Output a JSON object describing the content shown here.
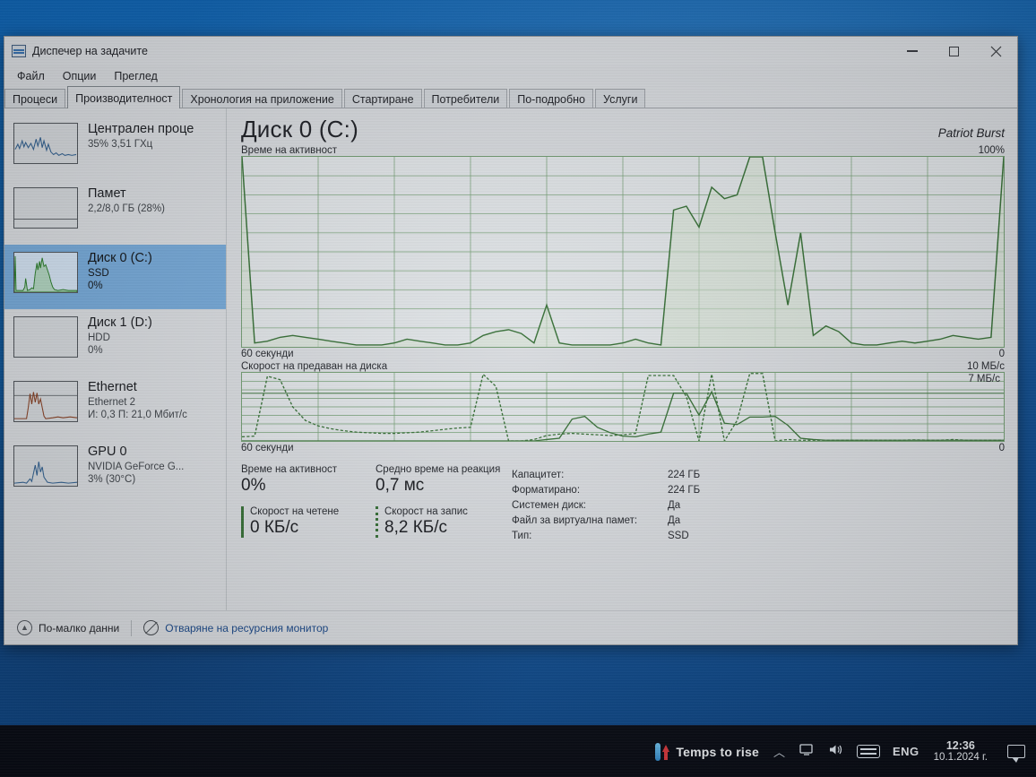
{
  "window": {
    "title": "Диспечер на задачите",
    "app_icon": "task-manager-icon",
    "minimize_label": "—",
    "maximize_label": "□",
    "close_label": "✕"
  },
  "menubar": {
    "items": [
      {
        "label": "Файл"
      },
      {
        "label": "Опции"
      },
      {
        "label": "Преглед"
      }
    ]
  },
  "tabs": {
    "active_index": 1,
    "items": [
      {
        "label": "Процеси"
      },
      {
        "label": "Производителност"
      },
      {
        "label": "Хронология на приложение"
      },
      {
        "label": "Стартиране"
      },
      {
        "label": "Потребители"
      },
      {
        "label": "По-подробно"
      },
      {
        "label": "Услуги"
      }
    ]
  },
  "sidebar": {
    "items": [
      {
        "title": "Централен проце",
        "sub1": "35% 3,51 ГХц",
        "sub2": "",
        "selected": false,
        "thumb": "cpu-sparkline"
      },
      {
        "title": "Памет",
        "sub1": "2,2/8,0 ГБ (28%)",
        "sub2": "",
        "selected": false,
        "thumb": "memory-sparkline"
      },
      {
        "title": "Диск 0 (C:)",
        "sub1": "SSD",
        "sub2": "0%",
        "selected": true,
        "thumb": "disk0-sparkline"
      },
      {
        "title": "Диск 1 (D:)",
        "sub1": "HDD",
        "sub2": "0%",
        "selected": false,
        "thumb": "disk1-sparkline"
      },
      {
        "title": "Ethernet",
        "sub1": "Ethernet 2",
        "sub2": "И: 0,3 П: 21,0 Мбит/с",
        "selected": false,
        "thumb": "ethernet-sparkline"
      },
      {
        "title": "GPU 0",
        "sub1": "NVIDIA GeForce G...",
        "sub2": "3% (30°C)",
        "selected": false,
        "thumb": "gpu-sparkline"
      }
    ]
  },
  "main": {
    "title": "Диск 0 (C:)",
    "model": "Patriot Burst",
    "activity_graph": {
      "caption": "Време на активност",
      "scale_max": "100%",
      "axis_left": "60 секунди",
      "axis_right": "0"
    },
    "transfer_graph": {
      "caption": "Скорост на предаван на диска",
      "scale_max": "10 МБ/с",
      "scale_inner": "7 МБ/с",
      "axis_left": "60 секунди",
      "axis_right": "0"
    },
    "stats": {
      "active_time_label": "Време на активност",
      "active_time_value": "0%",
      "avg_response_label": "Средно време на реакция",
      "avg_response_value": "0,7 мс",
      "read_label": "Скорост на четене",
      "read_value": "0 КБ/с",
      "write_label": "Скорост на запис",
      "write_value": "8,2 КБ/с",
      "info_rows": [
        {
          "key": "Капацитет:",
          "value": "224 ГБ"
        },
        {
          "key": "Форматирано:",
          "value": "224 ГБ"
        },
        {
          "key": "Системен диск:",
          "value": "Да"
        },
        {
          "key": "Файл за виртуална памет:",
          "value": "Да"
        },
        {
          "key": "Тип:",
          "value": "SSD"
        }
      ]
    }
  },
  "footer": {
    "fewer_details_label": "По-малко данни",
    "fewer_details_icon": "chevron-up-circle-icon",
    "resource_monitor_label": "Отваряне на ресурсния монитор",
    "resource_monitor_icon": "resource-monitor-icon"
  },
  "taskbar": {
    "temps_label": "Temps to rise",
    "temps_icon": "thermometer-icon",
    "chevron_icon": "chevron-up-icon",
    "network_icon": "network-icon",
    "volume_icon": "volume-icon",
    "keyboard_icon": "keyboard-icon",
    "language": "ENG",
    "time": "12:36",
    "date": "10.1.2024 г.",
    "notifications_icon": "action-center-icon"
  },
  "colors": {
    "graph_line": "#2f6e2f",
    "graph_fill": "#cfe0cd",
    "graph_border": "#6e9d6e",
    "selection": "#6fa8dc",
    "link": "#13458c",
    "window_bg": "#d7dade"
  },
  "chart_data": [
    {
      "type": "area",
      "id": "disk-active-time",
      "title": "Време на активност",
      "xlabel": "60 секунди",
      "ylabel": "%",
      "ylim": [
        0,
        100
      ],
      "grid": true,
      "x": [
        0,
        1,
        2,
        3,
        4,
        5,
        6,
        7,
        8,
        9,
        10,
        11,
        12,
        13,
        14,
        15,
        16,
        17,
        18,
        19,
        20,
        21,
        22,
        23,
        24,
        25,
        26,
        27,
        28,
        29,
        30,
        31,
        32,
        33,
        34,
        35,
        36,
        37,
        38,
        39,
        40,
        41,
        42,
        43,
        44,
        45,
        46,
        47,
        48,
        49,
        50,
        51,
        52,
        53,
        54,
        55,
        56,
        57,
        58,
        59,
        60
      ],
      "values": [
        100,
        2,
        3,
        5,
        6,
        5,
        4,
        3,
        2,
        1,
        1,
        1,
        2,
        4,
        3,
        2,
        1,
        1,
        2,
        6,
        8,
        9,
        7,
        2,
        22,
        2,
        1,
        1,
        1,
        1,
        2,
        4,
        2,
        1,
        72,
        74,
        63,
        84,
        78,
        80,
        100,
        100,
        60,
        22,
        60,
        6,
        11,
        8,
        2,
        1,
        1,
        2,
        3,
        2,
        3,
        4,
        6,
        5,
        4,
        5,
        100
      ]
    },
    {
      "type": "line",
      "id": "disk-transfer-rate",
      "title": "Скорост на предаван на диска",
      "xlabel": "60 секунди",
      "ylabel": "МБ/с",
      "ylim": [
        0,
        10
      ],
      "grid": true,
      "annotations": [
        "7 МБ/с"
      ],
      "series": [
        {
          "name": "Скорост на четене",
          "style": "solid",
          "values": [
            0,
            0,
            0,
            0,
            0,
            0,
            0,
            0,
            0,
            0,
            0,
            0,
            0,
            0,
            0,
            0,
            0,
            0,
            0,
            0,
            0,
            0,
            0,
            0,
            0.2,
            0.4,
            3.2,
            3.6,
            2.0,
            1.2,
            0.7,
            0.6,
            1.0,
            1.3,
            7.0,
            7.0,
            3.8,
            7.2,
            2.6,
            2.4,
            3.5,
            3.5,
            3.6,
            2.3,
            0.4,
            0.2,
            0.1,
            0.1,
            0.1,
            0.1,
            0.1,
            0.1,
            0.1,
            0.1,
            0.1,
            0.1,
            0.1,
            0.1,
            0.1,
            0.1,
            0.1
          ]
        },
        {
          "name": "Скорост на запис",
          "style": "dotted",
          "values": [
            0.6,
            0.7,
            9.5,
            9.0,
            5.0,
            3.0,
            2.2,
            1.8,
            1.5,
            1.3,
            1.2,
            1.1,
            1.1,
            1.2,
            1.3,
            1.5,
            1.7,
            1.9,
            2.0,
            9.8,
            8.0,
            0.0,
            0.0,
            0.2,
            0.8,
            1.0,
            1.1,
            1.0,
            0.9,
            0.8,
            0.9,
            1.1,
            9.6,
            9.6,
            9.6,
            6.5,
            0.0,
            9.8,
            0.0,
            3.0,
            9.9,
            9.9,
            0.0,
            0.2,
            0.1,
            0.1,
            0.1,
            0.1,
            0.1,
            0.1,
            0.1,
            0.1,
            0.1,
            0.15,
            0.1,
            0.1,
            0.2,
            0.1,
            0.1,
            0.1,
            0.1
          ]
        }
      ]
    }
  ]
}
